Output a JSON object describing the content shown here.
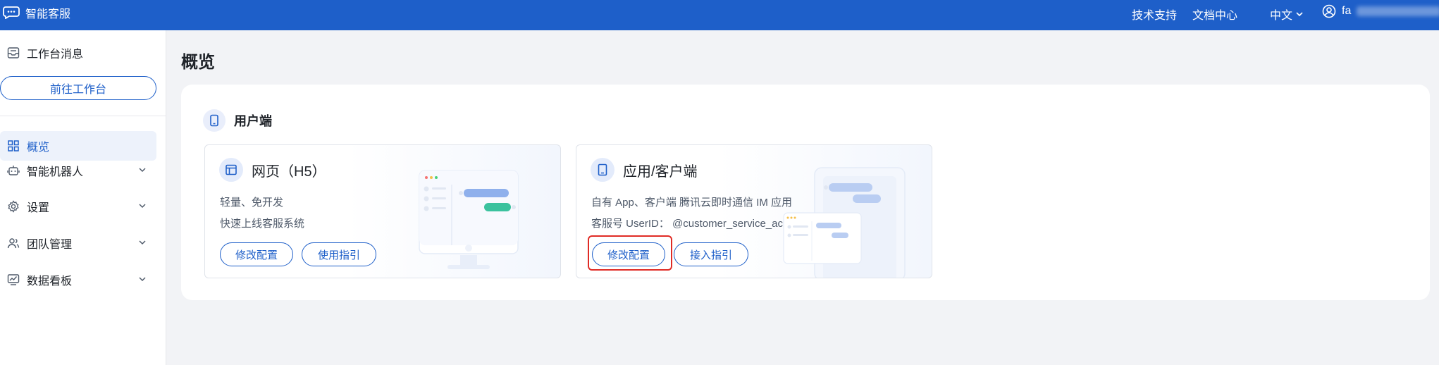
{
  "topbar": {
    "brand": "智能客服",
    "links": [
      "技术支持",
      "文档中心"
    ],
    "language": "中文",
    "user_name_prefix": "fa",
    "user_name_suffix": ".."
  },
  "sidebar": {
    "workbench_message": "工作台消息",
    "goto_button": "前往工作台",
    "items": [
      {
        "label": "概览",
        "icon": "grid-icon",
        "active": true
      },
      {
        "label": "智能机器人",
        "icon": "robot-icon"
      },
      {
        "label": "设置",
        "icon": "gear-icon"
      },
      {
        "label": "团队管理",
        "icon": "team-icon"
      },
      {
        "label": "数据看板",
        "icon": "chart-icon"
      }
    ]
  },
  "main": {
    "page_title": "概览",
    "section_title": "用户端",
    "web_card": {
      "title": "网页（H5）",
      "lines": [
        "轻量、免开发",
        "快速上线客服系统"
      ],
      "buttons": [
        "修改配置",
        "使用指引"
      ]
    },
    "app_card": {
      "title": "应用/客户端",
      "line1": "自有 App、客户端   腾讯云即时通信 IM 应用",
      "line2_label": "客服号 UserID：",
      "line2_value": "@customer_service_account",
      "buttons": [
        "修改配置",
        "接入指引"
      ]
    }
  },
  "colors": {
    "accent": "#1e5fc9",
    "highlight": "#e02b25"
  }
}
